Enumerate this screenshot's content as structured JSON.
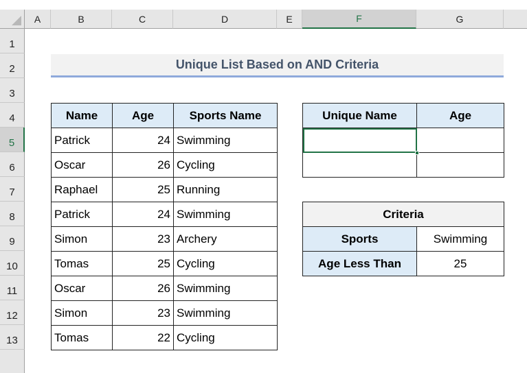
{
  "columns": [
    "A",
    "B",
    "C",
    "D",
    "E",
    "F",
    "G"
  ],
  "selected_column": "F",
  "rows": [
    "1",
    "2",
    "3",
    "4",
    "5",
    "6",
    "7",
    "8",
    "9",
    "10",
    "11",
    "12",
    "13"
  ],
  "selected_row": "5",
  "title": "Unique List Based on AND Criteria",
  "data_table": {
    "headers": [
      "Name",
      "Age",
      "Sports Name"
    ],
    "rows": [
      [
        "Patrick",
        "24",
        "Swimming"
      ],
      [
        "Oscar",
        "26",
        "Cycling"
      ],
      [
        "Raphael",
        "25",
        "Running"
      ],
      [
        "Patrick",
        "24",
        "Swimming"
      ],
      [
        "Simon",
        "23",
        "Archery"
      ],
      [
        "Tomas",
        "25",
        "Cycling"
      ],
      [
        "Oscar",
        "26",
        "Swimming"
      ],
      [
        "Simon",
        "23",
        "Swimming"
      ],
      [
        "Tomas",
        "22",
        "Cycling"
      ]
    ]
  },
  "result_table": {
    "headers": [
      "Unique Name",
      "Age"
    ],
    "rows": [
      [
        "",
        ""
      ],
      [
        "",
        ""
      ]
    ]
  },
  "criteria_table": {
    "header": "Criteria",
    "rows": [
      {
        "label": "Sports",
        "value": "Swimming"
      },
      {
        "label": "Age Less Than",
        "value": "25"
      }
    ]
  },
  "accent_color": "#217346"
}
